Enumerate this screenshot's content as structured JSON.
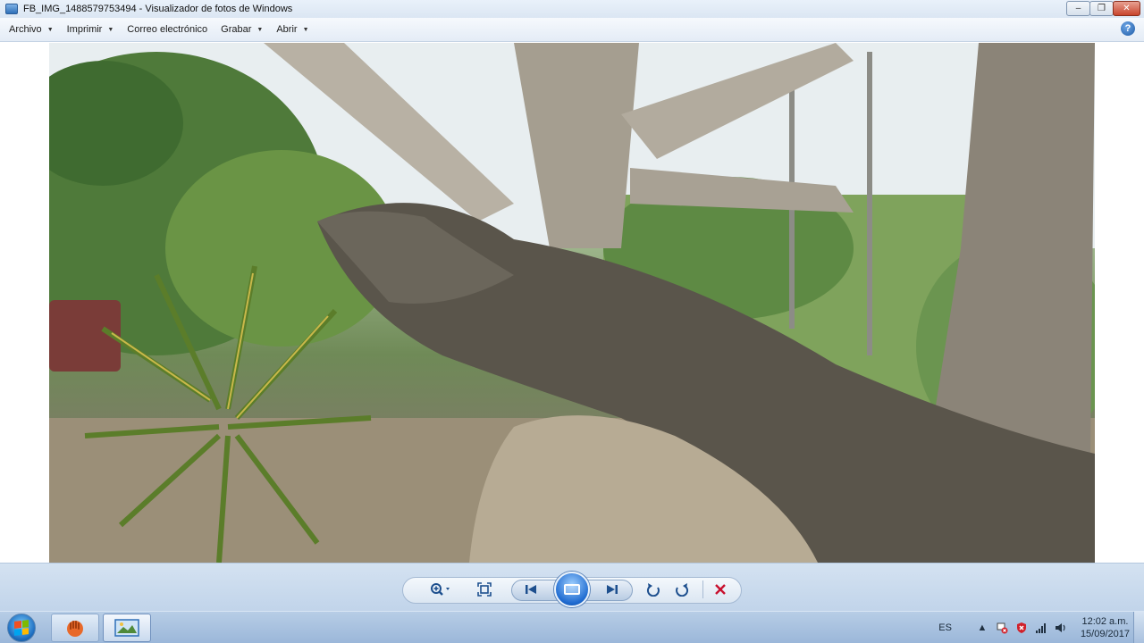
{
  "window": {
    "title": "FB_IMG_1488579753494 - Visualizador de fotos de Windows",
    "controls": {
      "minimize": "–",
      "maximize": "❐",
      "close": "✕"
    }
  },
  "menu": {
    "items": [
      {
        "label": "Archivo",
        "has_dropdown": true
      },
      {
        "label": "Imprimir",
        "has_dropdown": true
      },
      {
        "label": "Correo electrónico",
        "has_dropdown": false
      },
      {
        "label": "Grabar",
        "has_dropdown": true
      },
      {
        "label": "Abrir",
        "has_dropdown": true
      }
    ],
    "dropdown_arrow": "▼",
    "help": "?"
  },
  "photo": {
    "subject": "tree-trunk-photo"
  },
  "toolbar": {
    "buttons": [
      "zoom-icon",
      "fit-window-icon",
      "previous-icon",
      "slideshow-icon",
      "next-icon",
      "rotate-left-icon",
      "rotate-right-icon",
      "delete-icon"
    ],
    "colors": {
      "accent": "#1d4f8e",
      "delete": "#c8102e"
    }
  },
  "taskbar": {
    "language": "ES",
    "time": "12:02 a.m.",
    "date": "15/09/2017"
  }
}
